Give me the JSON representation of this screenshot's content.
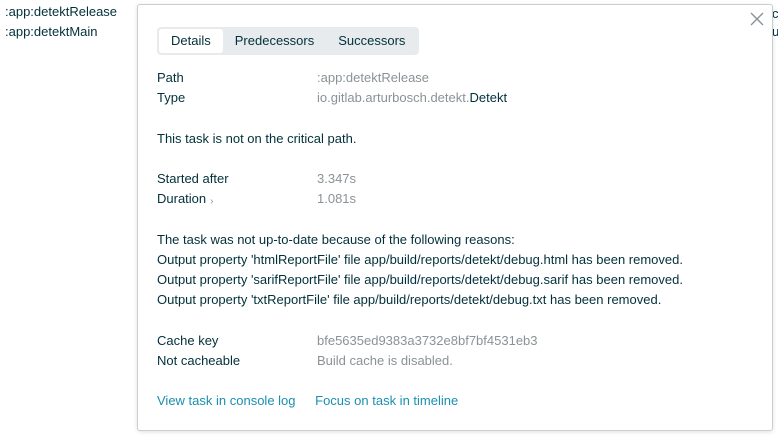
{
  "background": {
    "task_list": [
      ":app:detektRelease",
      ":app:detektMain"
    ],
    "edge_fragments": [
      "c",
      "ul"
    ]
  },
  "popup": {
    "tabs": [
      "Details",
      "Predecessors",
      "Successors"
    ],
    "active_tab": "Details",
    "path_label": "Path",
    "path_value": ":app:detektRelease",
    "type_label": "Type",
    "type_package": "io.gitlab.arturbosch.detekt.",
    "type_class": "Detekt",
    "critical_path_note": "This task is not on the critical path.",
    "started_after_label": "Started after",
    "started_after_value": "3.347s",
    "duration_label": "Duration",
    "duration_value": "1.081s",
    "reasons_heading": "The task was not up-to-date because of the following reasons:",
    "reasons": [
      "Output property 'htmlReportFile' file app/build/reports/detekt/debug.html has been removed.",
      "Output property 'sarifReportFile' file app/build/reports/detekt/debug.sarif has been removed.",
      "Output property 'txtReportFile' file app/build/reports/detekt/debug.txt has been removed."
    ],
    "cache_key_label": "Cache key",
    "cache_key_value": "bfe5635ed9383a3732e8bf7bf4531eb3",
    "not_cacheable_label": "Not cacheable",
    "not_cacheable_value": "Build cache is disabled.",
    "links": [
      "View task in console log",
      "Focus on task in timeline"
    ]
  },
  "colors": {
    "text": "#02303a",
    "muted": "#8a9296",
    "link": "#1a8fb0",
    "tab_bg": "#e8ebed"
  }
}
